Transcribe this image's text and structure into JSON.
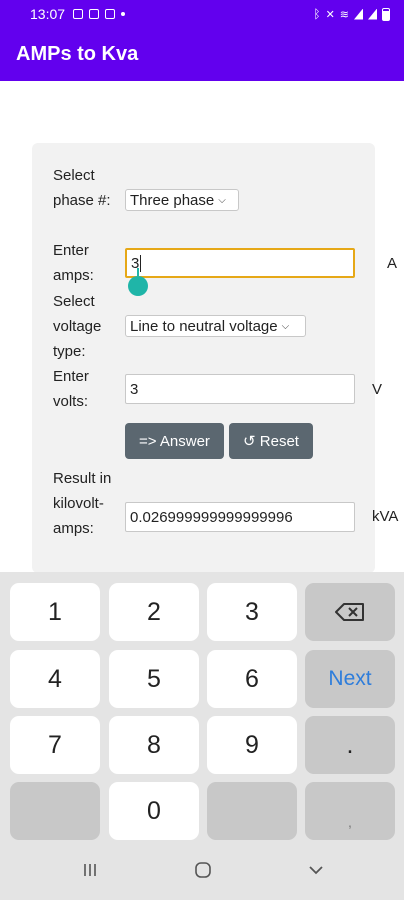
{
  "status_bar": {
    "time": "13:07",
    "battery": "",
    "icons": [
      "gallery-icon",
      "gallery-icon",
      "save-icon",
      "dot-icon",
      "bluetooth-icon",
      "mute-icon",
      "wifi-icon",
      "signal-icon",
      "signal-icon",
      "battery-icon"
    ]
  },
  "app_bar": {
    "title": "AMPs to Kva",
    "color": "#6200ee"
  },
  "form": {
    "phase_label": "Select phase #:",
    "phase_value": "Three phase",
    "amps_label": "Enter amps:",
    "amps_value": "3",
    "amps_unit": "A",
    "voltage_type_label": "Select voltage type:",
    "voltage_type_value": "Line to neutral voltage",
    "volts_label": "Enter volts:",
    "volts_value": "3",
    "volts_unit": "V",
    "answer_button": "=> Answer",
    "reset_button": "↺ Reset",
    "result_label": "Result in kilovolt-amps:",
    "result_value": "0.026999999999999996",
    "result_unit": "kVA"
  },
  "keyboard": {
    "keys": [
      "1",
      "2",
      "3",
      "4",
      "5",
      "6",
      "7",
      "8",
      "9",
      "0",
      "."
    ],
    "next_label": "Next",
    "comma": ","
  },
  "nav_bar": {
    "icons": [
      "recent-apps-icon",
      "home-icon",
      "back-icon"
    ]
  }
}
